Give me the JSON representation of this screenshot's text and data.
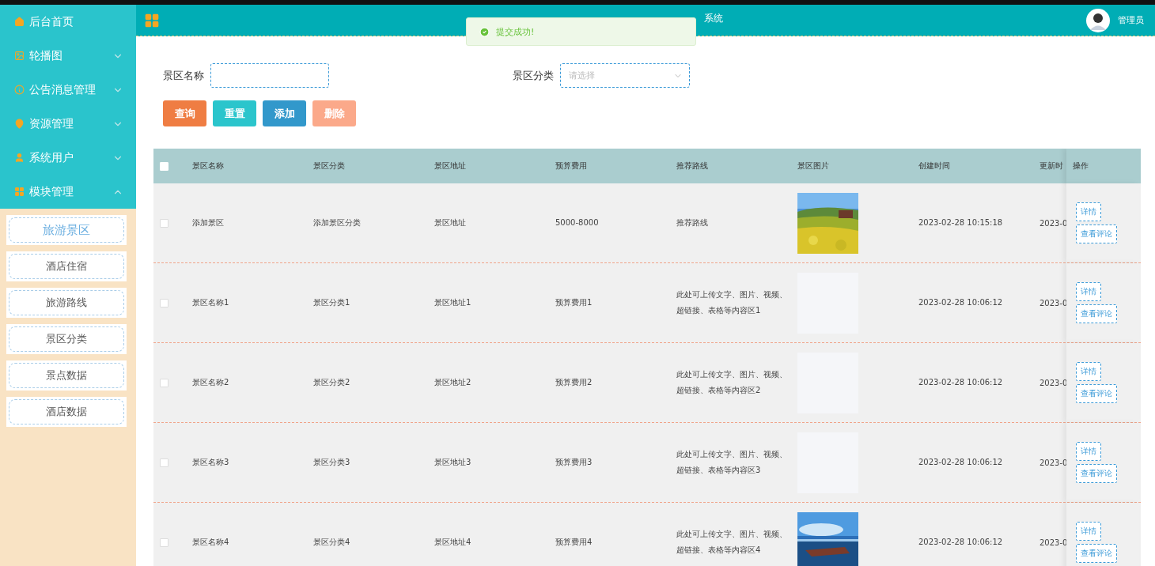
{
  "sidebar": {
    "items": [
      {
        "label": "后台首页",
        "kind": "link"
      },
      {
        "label": "轮播图",
        "kind": "group",
        "expanded": false
      },
      {
        "label": "公告消息管理",
        "kind": "group",
        "expanded": false
      },
      {
        "label": "资源管理",
        "kind": "group",
        "expanded": false
      },
      {
        "label": "系统用户",
        "kind": "group",
        "expanded": false
      },
      {
        "label": "模块管理",
        "kind": "group",
        "expanded": true
      }
    ],
    "submenu": [
      {
        "label": "旅游景区",
        "selected": true
      },
      {
        "label": "酒店住宿",
        "selected": false
      },
      {
        "label": "旅游路线",
        "selected": false
      },
      {
        "label": "景区分类",
        "selected": false
      },
      {
        "label": "景点数据",
        "selected": false
      },
      {
        "label": "酒店数据",
        "selected": false
      }
    ]
  },
  "header": {
    "title": "系统",
    "user": "管理员"
  },
  "toast": {
    "message": "提交成功!"
  },
  "search": {
    "fields": [
      {
        "label": "景区名称",
        "kind": "input"
      },
      {
        "label": "景区分类",
        "kind": "select",
        "placeholder": "请选择"
      }
    ],
    "buttons": [
      {
        "label": "查询",
        "color": "#ef7d43"
      },
      {
        "label": "重置",
        "color": "#2bc5cc"
      },
      {
        "label": "添加",
        "color": "#3298cb"
      },
      {
        "label": "删除",
        "color": "#fba98a"
      }
    ]
  },
  "table": {
    "columns": [
      "景区名称",
      "景区分类",
      "景区地址",
      "预算费用",
      "推荐路线",
      "景区图片",
      "创建时间",
      "更新时",
      "操作"
    ],
    "header_checked": false,
    "rows": [
      {
        "checked": false,
        "cells": [
          "添加景区",
          "添加景区分类",
          "景区地址",
          "5000-8000",
          "推荐路线"
        ],
        "image": {
          "kind": "field"
        },
        "created": "2023-02-28 10:15:18",
        "updated": "2023-0",
        "actions": [
          "详情",
          "查看评论"
        ]
      },
      {
        "checked": false,
        "cells": [
          "景区名称1",
          "景区分类1",
          "景区地址1",
          "预算费用1",
          "此处可上传文字、图片、视频、超链接、表格等内容区1"
        ],
        "image": {
          "kind": "empty"
        },
        "created": "2023-02-28 10:06:12",
        "updated": "2023-0",
        "actions": [
          "详情",
          "查看评论"
        ]
      },
      {
        "checked": false,
        "cells": [
          "景区名称2",
          "景区分类2",
          "景区地址2",
          "预算费用2",
          "此处可上传文字、图片、视频、超链接、表格等内容区2"
        ],
        "image": {
          "kind": "empty"
        },
        "created": "2023-02-28 10:06:12",
        "updated": "2023-0",
        "actions": [
          "详情",
          "查看评论"
        ]
      },
      {
        "checked": false,
        "cells": [
          "景区名称3",
          "景区分类3",
          "景区地址3",
          "预算费用3",
          "此处可上传文字、图片、视频、超链接、表格等内容区3"
        ],
        "image": {
          "kind": "empty"
        },
        "created": "2023-02-28 10:06:12",
        "updated": "2023-0",
        "actions": [
          "详情",
          "查看评论"
        ]
      },
      {
        "checked": false,
        "cells": [
          "景区名称4",
          "景区分类4",
          "景区地址4",
          "预算费用4",
          "此处可上传文字、图片、视频、超链接、表格等内容区4"
        ],
        "image": {
          "kind": "sea"
        },
        "created": "2023-02-28 10:06:12",
        "updated": "2023-0",
        "actions": [
          "详情",
          "查看评论"
        ]
      }
    ]
  }
}
